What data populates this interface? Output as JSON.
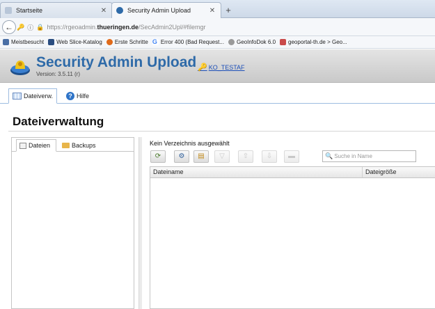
{
  "browser": {
    "tabs": [
      {
        "label": "Startseite",
        "active": false
      },
      {
        "label": "Security Admin Upload",
        "active": true
      }
    ],
    "new_tab": "+",
    "url": {
      "prefix": "https://rgeoadmin.",
      "host": "thueringen.de",
      "path": "/SecAdmin2Upl/#filemgr"
    },
    "bookmarks": [
      {
        "label": "Meistbesucht",
        "color": "#4a6fa5"
      },
      {
        "label": "Web Slice-Katalog",
        "color": "#2a4d80"
      },
      {
        "label": "Erste Schritte",
        "color": "#e06a1a"
      },
      {
        "label": "Error 400 (Bad Request...",
        "color": "#4285f4"
      },
      {
        "label": "GeoInfoDok 6.0",
        "color": "#8a8a8a"
      },
      {
        "label": "geoportal-th.de > Geo...",
        "color": "#c94a4a"
      }
    ]
  },
  "app": {
    "title": "Security Admin Upload",
    "version": "Version: 3.5.11 (r)",
    "user": "KO_TESTAF",
    "tabs": [
      {
        "label": "Dateiverw.",
        "icon": "grid-icon"
      },
      {
        "label": "Hilfe",
        "icon": "help-icon"
      }
    ]
  },
  "page": {
    "title": "Dateiverwaltung",
    "left_tabs": [
      {
        "label": "Dateien",
        "icon": "file-icon"
      },
      {
        "label": "Backups",
        "icon": "folder-icon"
      }
    ],
    "directory_status": "Kein Verzeichnis ausgewählt",
    "search_placeholder": "Suche in Name",
    "columns": [
      "Dateiname",
      "Dateigröße"
    ],
    "colors": {
      "accent": "#2e6aa8",
      "link": "#1c4fb8"
    }
  }
}
